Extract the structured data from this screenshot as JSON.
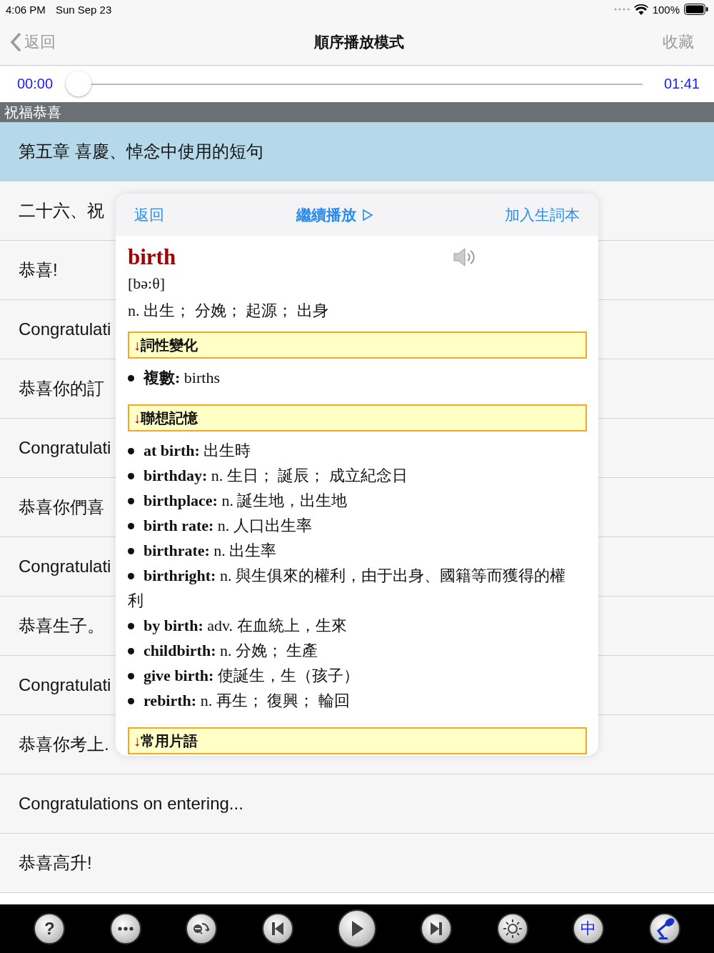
{
  "status_bar": {
    "time": "4:06 PM",
    "date": "Sun Sep 23",
    "battery": "100%"
  },
  "nav": {
    "back": "返回",
    "title": "順序播放模式",
    "action": "收藏"
  },
  "player": {
    "current": "00:00",
    "total": "01:41",
    "level": 0
  },
  "section_header": "祝福恭喜",
  "rows": [
    {
      "text": "第五章  喜慶、悼念中使用的短句",
      "selected": true
    },
    {
      "text": "二十六、祝",
      "selected": false
    },
    {
      "text": "恭喜!",
      "selected": false
    },
    {
      "text": "Congratulati",
      "selected": false
    },
    {
      "text": "恭喜你的訂",
      "selected": false
    },
    {
      "text": "Congratulati",
      "selected": false
    },
    {
      "text": "恭喜你們喜",
      "selected": false
    },
    {
      "text": "Congratulati",
      "selected": false
    },
    {
      "text": "恭喜生子。",
      "selected": false
    },
    {
      "text": "Congratulati",
      "selected": false
    },
    {
      "text": "恭喜你考上.",
      "selected": false
    },
    {
      "text": "Congratulations on entering...",
      "selected": false
    },
    {
      "text": "恭喜高升!",
      "selected": false
    }
  ],
  "popup": {
    "back": "返回",
    "continue": "繼續播放",
    "add": "加入生詞本",
    "word": "birth",
    "phonetic": "[bə:θ]",
    "definition": "n. 出生； 分娩； 起源； 出身",
    "sections": [
      {
        "arrow": "↓",
        "title": "詞性變化",
        "items": [
          {
            "term": "複數:",
            "text": "births"
          }
        ]
      },
      {
        "arrow": "↓",
        "title": "聯想記憶",
        "items": [
          {
            "term": "at birth:",
            "text": "出生時"
          },
          {
            "term": "birthday:",
            "text": "n. 生日； 誕辰； 成立紀念日"
          },
          {
            "term": "birthplace:",
            "text": "n. 誕生地，出生地"
          },
          {
            "term": "birth rate:",
            "text": "n. 人口出生率"
          },
          {
            "term": "birthrate:",
            "text": "n. 出生率"
          },
          {
            "term": "birthright:",
            "text": "n. 與生俱來的權利，由于出身、國籍等而獲得的權利"
          },
          {
            "term": "by birth:",
            "text": "adv. 在血統上，生來"
          },
          {
            "term": "childbirth:",
            "text": "n. 分娩； 生產"
          },
          {
            "term": "give birth:",
            "text": "使誕生，生（孩子）"
          },
          {
            "term": "rebirth:",
            "text": "n. 再生； 復興； 輪回"
          }
        ]
      },
      {
        "arrow": "↓",
        "title": "常用片語"
      }
    ]
  },
  "toolbar": [
    {
      "kind": "text",
      "label": "?"
    },
    {
      "kind": "more"
    },
    {
      "kind": "loop"
    },
    {
      "kind": "prev"
    },
    {
      "kind": "play"
    },
    {
      "kind": "next"
    },
    {
      "kind": "brightness"
    },
    {
      "kind": "lang",
      "label": "中"
    },
    {
      "kind": "mic"
    }
  ]
}
